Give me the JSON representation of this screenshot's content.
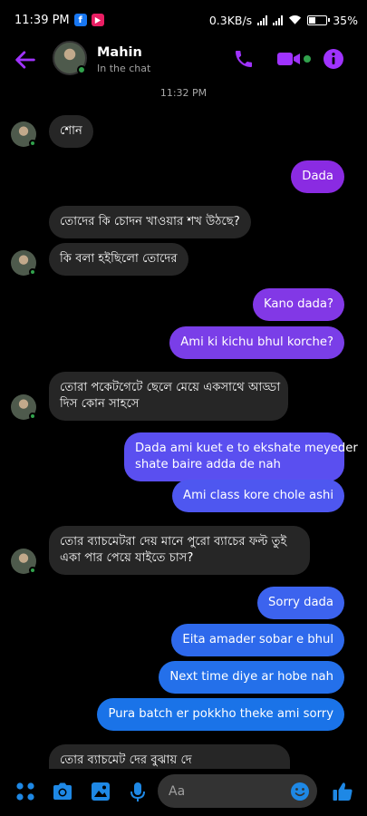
{
  "status_bar": {
    "time": "11:39 PM",
    "net_speed": "0.3KB/s",
    "battery": "35%"
  },
  "header": {
    "contact_name": "Mahin",
    "contact_status": "In the chat",
    "back_icon": "back-arrow-icon",
    "call_icon": "phone-icon",
    "video_icon": "video-camera-icon",
    "info_icon": "info-icon"
  },
  "chat": {
    "timestamp": "11:32 PM",
    "messages": [
      {
        "dir": "in",
        "text": "শোন"
      },
      {
        "dir": "out",
        "text": "Dada"
      },
      {
        "dir": "in",
        "text": "তোদের কি চোদন খাওয়ার শখ উঠছে?"
      },
      {
        "dir": "in",
        "text": "কি বলা হইছিলো তোদের"
      },
      {
        "dir": "out",
        "text": "Kano dada?"
      },
      {
        "dir": "out",
        "text": "Ami ki kichu bhul korche?"
      },
      {
        "dir": "in",
        "lines": [
          "তোরা পকেটগেটে ছেলে মেয়ে একসাথে আড্ডা",
          "দিস কোন সাহসে"
        ]
      },
      {
        "dir": "out",
        "lines": [
          "Dada ami kuet e to ekshate meyeder",
          "shate baire adda de nah"
        ]
      },
      {
        "dir": "out",
        "text": "Ami class kore chole ashi"
      },
      {
        "dir": "in",
        "lines": [
          "তোর ব্যাচমেটরা দেয় মানে পুরো ব্যাচের ফল্ট তুই",
          "একা পার পেয়ে যাইতে চাস?"
        ]
      },
      {
        "dir": "out",
        "text": "Sorry dada"
      },
      {
        "dir": "out",
        "text": "Eita amader sobar e bhul"
      },
      {
        "dir": "out",
        "text": "Next time diye ar hobe nah"
      },
      {
        "dir": "out",
        "text": "Pura batch er pokkho theke ami sorry"
      },
      {
        "dir": "in",
        "text": "তোর ব্যাচমেট দের বুঝায় দে"
      }
    ]
  },
  "composer": {
    "placeholder": "Aa",
    "icons": [
      "apps-icon",
      "camera-icon",
      "gallery-icon",
      "mic-icon",
      "emoji-icon",
      "like-icon"
    ]
  },
  "colors": {
    "accent_purple": "#a033ff",
    "bubble_incoming": "#262626",
    "bubble_out_top": "#8a2be2",
    "bubble_out_mid": "#5e4ff0",
    "bubble_out_bottom": "#1a73e8",
    "online_green": "#31a24c",
    "icon_blue": "#1e88e5"
  }
}
